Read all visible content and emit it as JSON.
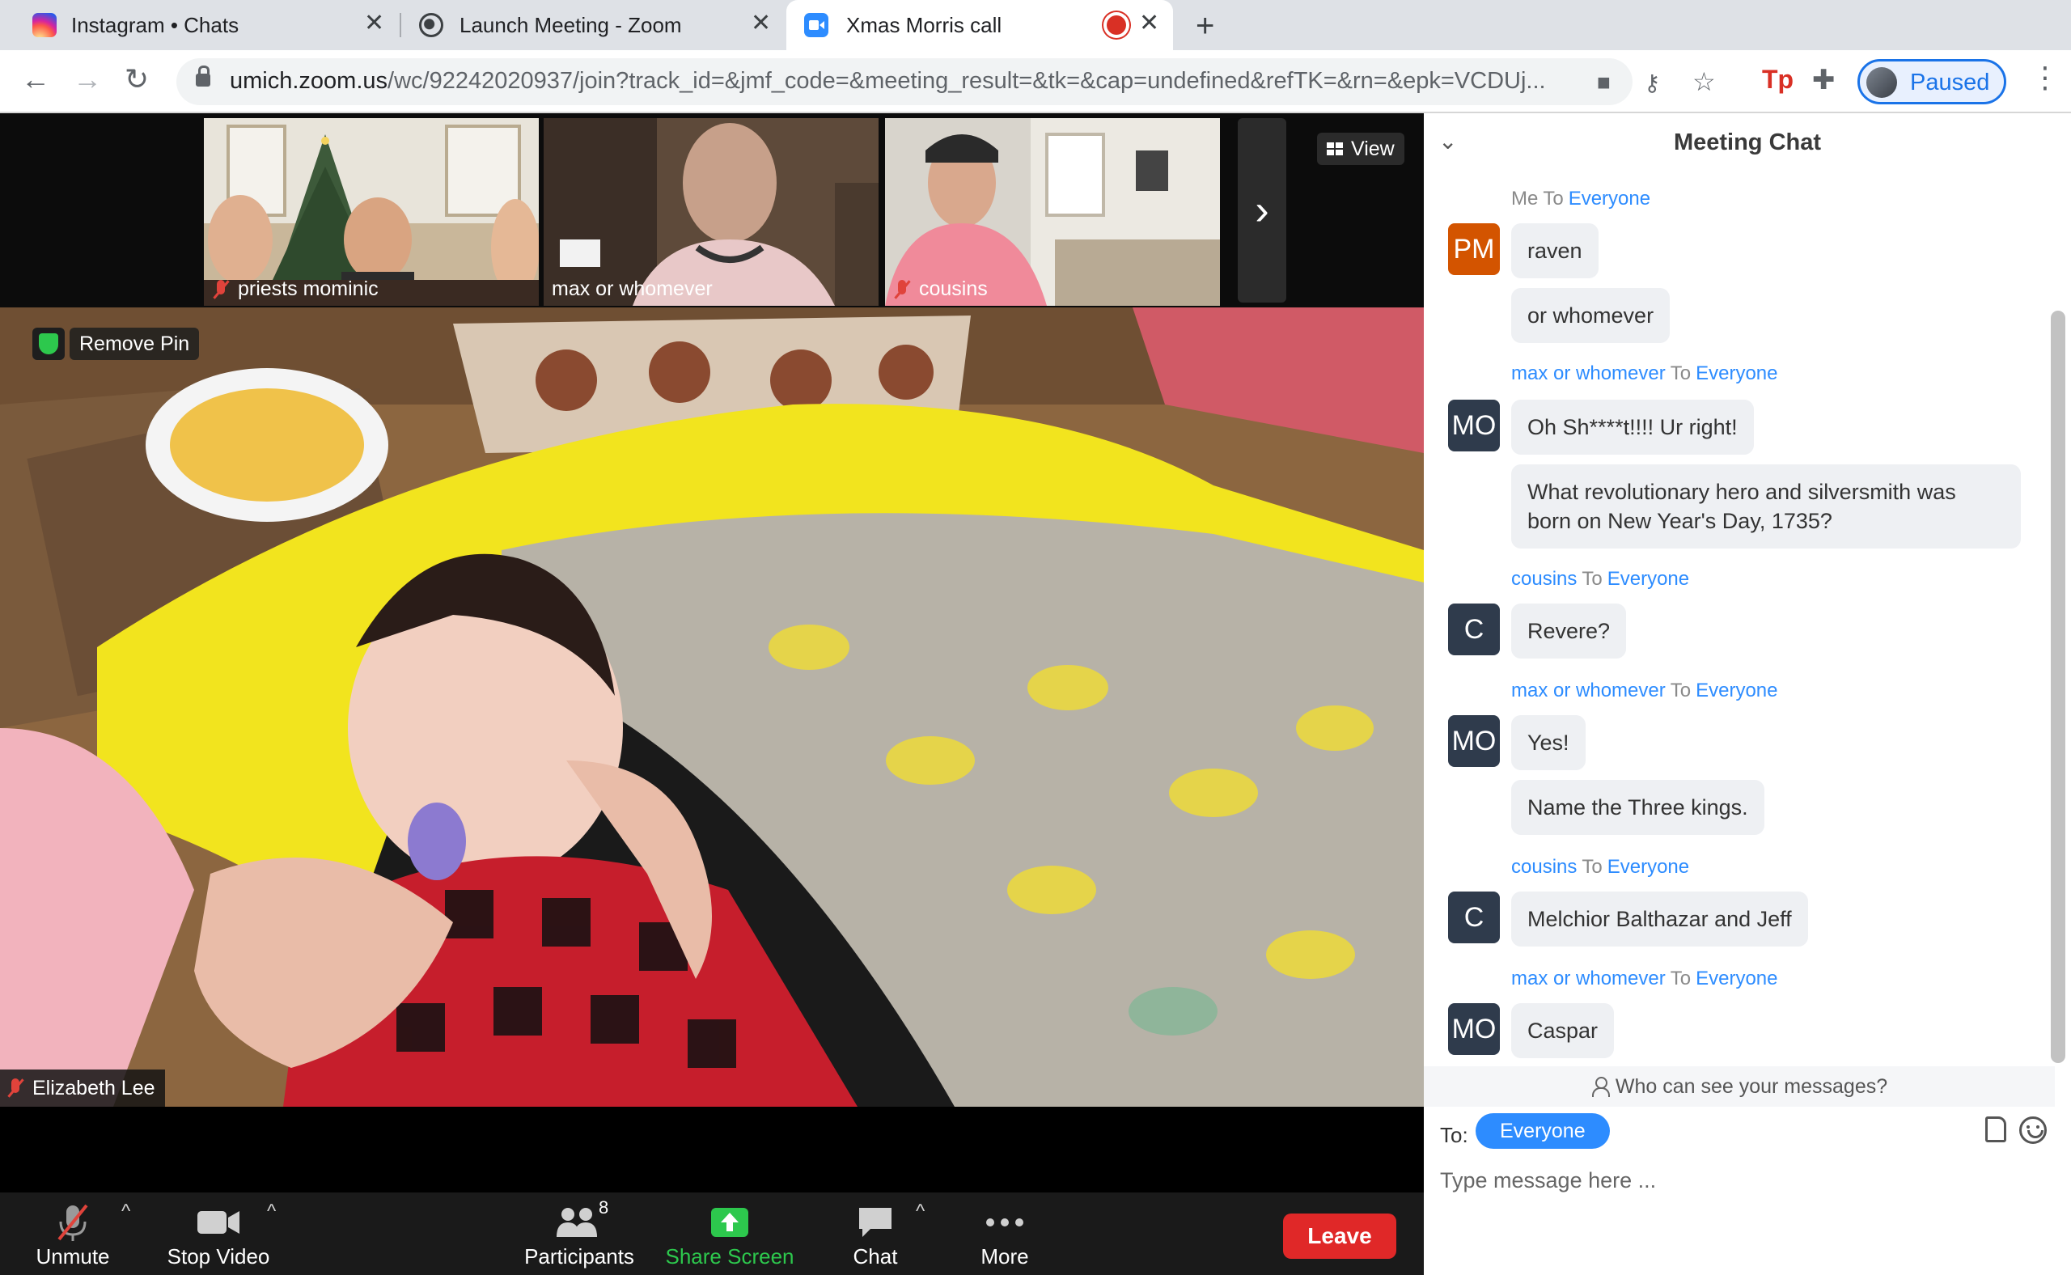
{
  "browser": {
    "tabs": [
      {
        "title": "Instagram • Chats",
        "icon": "instagram-icon",
        "active": false
      },
      {
        "title": "Launch Meeting - Zoom",
        "icon": "globe-icon",
        "active": false
      },
      {
        "title": "Xmas Morris call",
        "icon": "zoom-icon",
        "active": true,
        "recording": true
      }
    ],
    "url_host": "umich.zoom.us",
    "url_path": "/wc/92242020937/join?track_id=&jmf_code=&meeting_result=&tk=&cap=undefined&refTK=&rn=&epk=VCDUj...",
    "profile_label": "Paused",
    "accent": "#1a73e8"
  },
  "video": {
    "thumbnails": [
      {
        "name": "priests mominic",
        "muted": true
      },
      {
        "name": "max or whomever",
        "muted": false
      },
      {
        "name": "cousins",
        "muted": true
      }
    ],
    "view_label": "View",
    "remove_pin_label": "Remove Pin",
    "main_speaker": "Elizabeth Lee",
    "main_muted": true
  },
  "controls": {
    "unmute": "Unmute",
    "stop_video": "Stop Video",
    "participants": "Participants",
    "participant_count": "8",
    "share_screen": "Share Screen",
    "chat": "Chat",
    "more": "More",
    "leave": "Leave",
    "share_color": "#2dc84d",
    "leave_color": "#e02828"
  },
  "chat": {
    "title": "Meeting Chat",
    "groups": [
      {
        "sender": "Me",
        "to": "To",
        "target": "Everyone",
        "initials": "PM",
        "avatar_color": "#d35400",
        "messages": [
          "raven",
          "or whomever"
        ]
      },
      {
        "sender": "max or whomever",
        "to": "To",
        "target": "Everyone",
        "initials": "MO",
        "avatar_color": "#2f3b4c",
        "messages": [
          "Oh Sh****t!!!! Ur right!",
          "What revolutionary hero and silversmith was born on New Year's Day, 1735?"
        ]
      },
      {
        "sender": "cousins",
        "to": "To",
        "target": "Everyone",
        "initials": "C",
        "avatar_color": "#2f3b4c",
        "messages": [
          "Revere?"
        ]
      },
      {
        "sender": "max or whomever",
        "to": "To",
        "target": "Everyone",
        "initials": "MO",
        "avatar_color": "#2f3b4c",
        "messages": [
          "Yes!",
          "Name the Three kings."
        ]
      },
      {
        "sender": "cousins",
        "to": "To",
        "target": "Everyone",
        "initials": "C",
        "avatar_color": "#2f3b4c",
        "messages": [
          "Melchior Balthazar and Jeff"
        ]
      },
      {
        "sender": "max or whomever",
        "to": "To",
        "target": "Everyone",
        "initials": "MO",
        "avatar_color": "#2f3b4c",
        "messages": [
          "Caspar"
        ]
      }
    ],
    "who_can_see": "Who can see your messages?",
    "to_label": "To:",
    "to_target": "Everyone",
    "input_placeholder": "Type message here ...",
    "link_color": "#2d8cff"
  }
}
